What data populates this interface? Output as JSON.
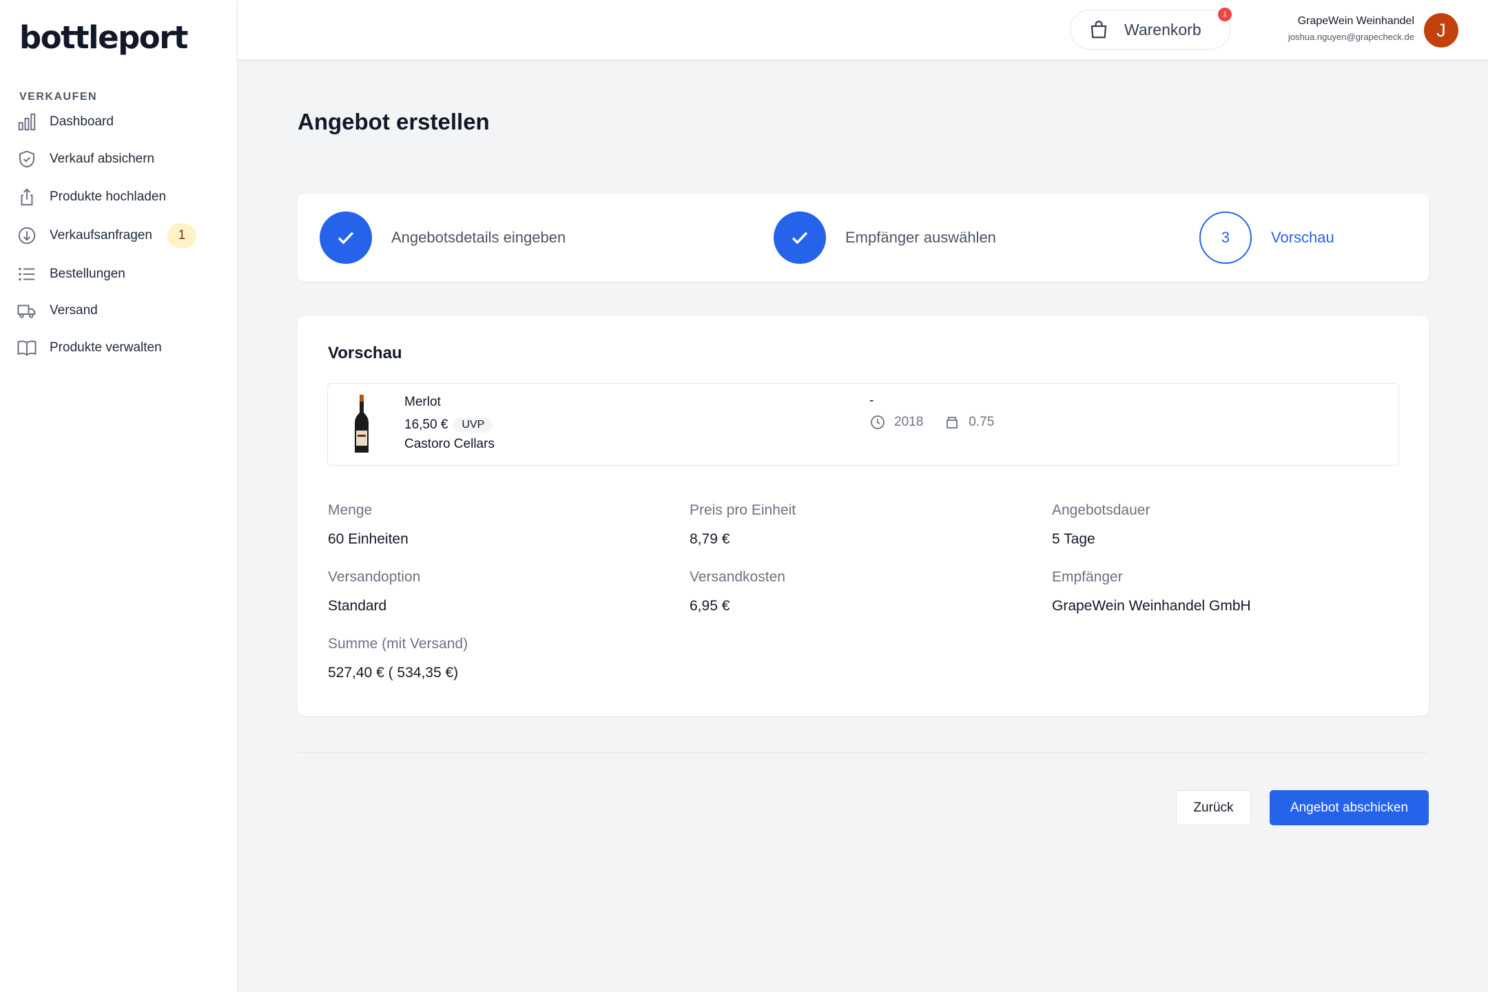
{
  "brand": {
    "logo_text": "bottleport"
  },
  "sidebar": {
    "section_label": "VERKAUFEN",
    "items": [
      {
        "label": "Dashboard",
        "icon": "bar-chart-icon"
      },
      {
        "label": "Verkauf absichern",
        "icon": "shield-check-icon"
      },
      {
        "label": "Produkte hochladen",
        "icon": "upload-icon"
      },
      {
        "label": "Verkaufsanfragen",
        "icon": "arrow-down-circle-icon",
        "badge": "1"
      },
      {
        "label": "Bestellungen",
        "icon": "list-icon"
      },
      {
        "label": "Versand",
        "icon": "truck-icon"
      },
      {
        "label": "Produkte verwalten",
        "icon": "book-open-icon"
      }
    ]
  },
  "header": {
    "cart_label": "Warenkorb",
    "cart_count": "1",
    "user_name": "GrapeWein Weinhandel",
    "user_email": "joshua.nguyen@grapecheck.de",
    "avatar_initial": "J"
  },
  "page": {
    "title": "Angebot erstellen"
  },
  "stepper": {
    "steps": [
      {
        "label": "Angebotsdetails eingeben",
        "status": "done"
      },
      {
        "label": "Empfänger auswählen",
        "status": "done"
      },
      {
        "label": "Vorschau",
        "status": "current",
        "number": "3"
      }
    ]
  },
  "preview": {
    "title": "Vorschau",
    "product": {
      "name": "Merlot",
      "price": "16,50 €",
      "price_badge": "UVP",
      "producer": "Castoro Cellars",
      "dash": "-",
      "vintage": "2018",
      "volume": "0.75"
    },
    "details": {
      "menge_label": "Menge",
      "menge_value": "60  Einheiten",
      "preis_label": "Preis pro Einheit",
      "preis_value": "8,79 €",
      "dauer_label": "Angebotsdauer",
      "dauer_value": "5 Tage",
      "versandoption_label": "Versandoption",
      "versandoption_value": "Standard",
      "versandkosten_label": "Versandkosten",
      "versandkosten_value": "6,95 €",
      "empfaenger_label": "Empfänger",
      "empfaenger_value": "GrapeWein Weinhandel GmbH",
      "summe_label": "Summe (mit Versand)",
      "summe_value": "527,40 € ( 534,35 €)"
    }
  },
  "actions": {
    "back_label": "Zurück",
    "submit_label": "Angebot abschicken"
  },
  "colors": {
    "primary": "#2563eb",
    "badge_bg": "#fef3c7",
    "avatar_bg": "#c2410c",
    "cart_badge": "#ef4444"
  }
}
